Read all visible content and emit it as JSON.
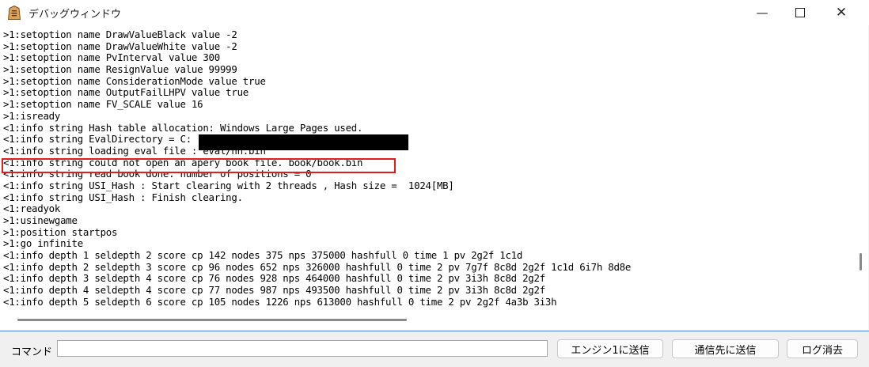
{
  "window": {
    "title": "デバッグウィンドウ",
    "controls": {
      "minimize": "—",
      "close": "✕"
    }
  },
  "log": {
    "lines": [
      ">1:setoption name DrawValueBlack value -2",
      ">1:setoption name DrawValueWhite value -2",
      ">1:setoption name PvInterval value 300",
      ">1:setoption name ResignValue value 99999",
      ">1:setoption name ConsiderationMode value true",
      ">1:setoption name OutputFailLHPV value true",
      ">1:setoption name FV_SCALE value 16",
      ">1:isready",
      "<1:info string Hash table allocation: Windows Large Pages used.",
      "<1:info string EvalDirectory = C:",
      "<1:info string loading eval file : eval/nn.bin",
      "<1:info string could not open an apery book file. book/book.bin",
      "<1:info string read book done. number of positions = 0",
      "<1:info string USI_Hash : Start clearing with 2 threads , Hash size =  1024[MB]",
      "<1:info string USI_Hash : Finish clearing.",
      "<1:readyok",
      ">1:usinewgame",
      ">1:position startpos",
      ">1:go infinite",
      "<1:info depth 1 seldepth 2 score cp 142 nodes 375 nps 375000 hashfull 0 time 1 pv 2g2f 1c1d",
      "<1:info depth 2 seldepth 3 score cp 96 nodes 652 nps 326000 hashfull 0 time 2 pv 7g7f 8c8d 2g2f 1c1d 6i7h 8d8e",
      "<1:info depth 3 seldepth 4 score cp 76 nodes 928 nps 464000 hashfull 0 time 2 pv 3i3h 8c8d 2g2f",
      "<1:info depth 4 seldepth 4 score cp 77 nodes 987 nps 493500 hashfull 0 time 2 pv 3i3h 8c8d 2g2f",
      "<1:info depth 5 seldepth 6 score cp 105 nodes 1226 nps 613000 hashfull 0 time 2 pv 2g2f 4a3b 3i3h"
    ]
  },
  "command": {
    "label": "コマンド",
    "value": "",
    "placeholder": ""
  },
  "buttons": {
    "send_engine1": "エンジン1に送信",
    "send_peer": "通信先に送信",
    "clear_log": "ログ消去"
  },
  "colors": {
    "highlight": "#e01e1e",
    "redaction": "#000000",
    "accent_line": "#4a7fd6"
  },
  "icons": {
    "app": "shogi-piece-icon",
    "minimize": "minimize-icon",
    "maximize": "maximize-icon",
    "close": "close-icon"
  }
}
